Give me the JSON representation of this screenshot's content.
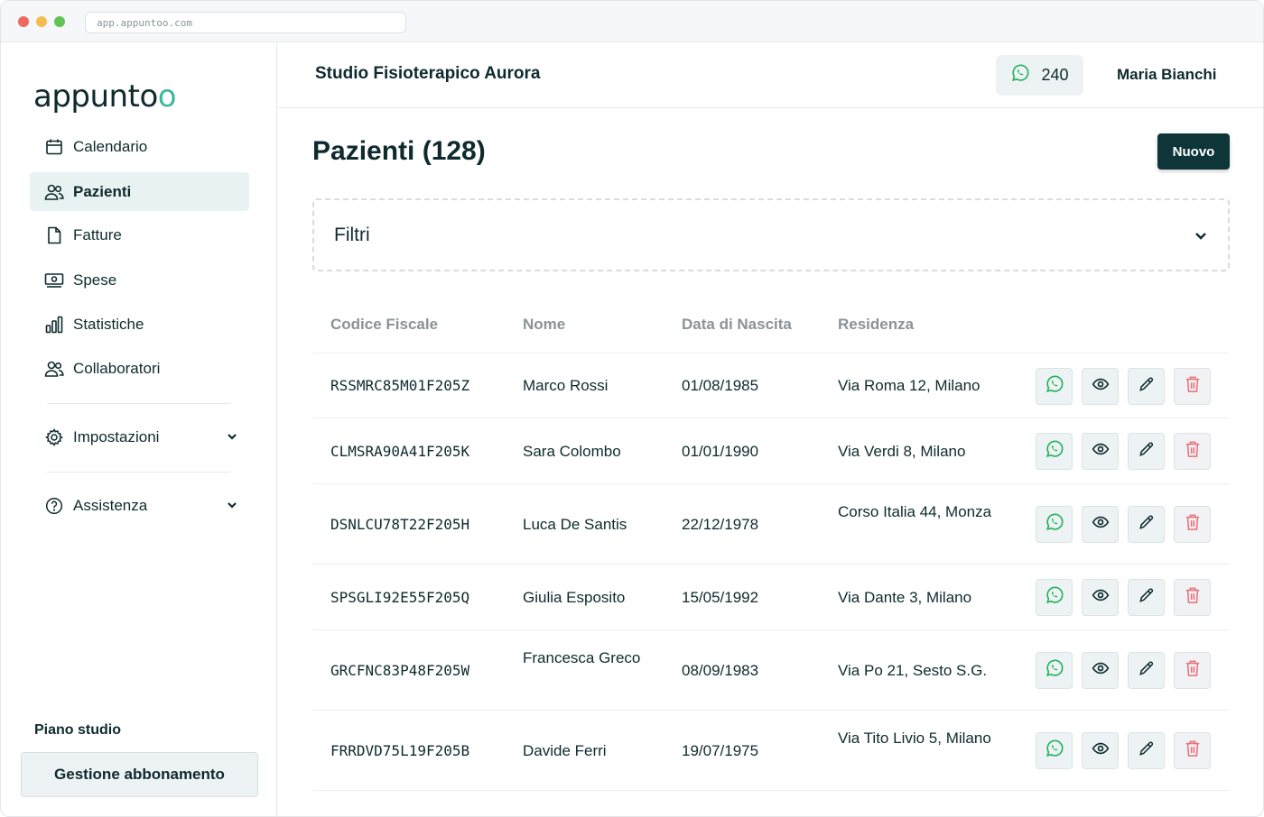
{
  "browser": {
    "url": "app.appuntoo.com"
  },
  "brand": {
    "logo_main": "appunt",
    "logo_o1": "o",
    "logo_o2": "o"
  },
  "sidebar": {
    "items": [
      {
        "label": "Calendario",
        "icon": "calendar-icon"
      },
      {
        "label": "Pazienti",
        "icon": "users-icon",
        "active": true
      },
      {
        "label": "Fatture",
        "icon": "file-icon"
      },
      {
        "label": "Spese",
        "icon": "cash-icon"
      },
      {
        "label": "Statistiche",
        "icon": "chart-icon"
      },
      {
        "label": "Collaboratori",
        "icon": "users-icon"
      },
      {
        "label": "Impostazioni",
        "icon": "gear-icon"
      },
      {
        "label": "Assistenza",
        "icon": "help-icon"
      }
    ],
    "plan_label": "Piano studio",
    "plan_button": "Gestione abbonamento"
  },
  "header": {
    "studio_name": "Studio Fisioterapico Aurora",
    "whatsapp_count": "240",
    "user_name": "Maria Bianchi"
  },
  "main": {
    "title": "Pazienti (128)",
    "new_button": "Nuovo",
    "filters_label": "Filtri",
    "columns": [
      "Codice Fiscale",
      "Nome",
      "Data di Nascita",
      "Residenza"
    ],
    "rows": [
      {
        "cf": "RSSMRC85M01F205Z",
        "name": "Marco Rossi",
        "dob": "01/08/1985",
        "address": "Via Roma 12, Milano"
      },
      {
        "cf": "CLMSRA90A41F205K",
        "name": "Sara Colombo",
        "dob": "01/01/1990",
        "address": "Via Verdi 8, Milano"
      },
      {
        "cf": "DSNLCU78T22F205H",
        "name": "Luca De Santis",
        "dob": "22/12/1978",
        "address": "Corso Italia 44, Monza"
      },
      {
        "cf": "SPSGLI92E55F205Q",
        "name": "Giulia Esposito",
        "dob": "15/05/1992",
        "address": "Via Dante 3, Milano"
      },
      {
        "cf": "GRCFNC83P48F205W",
        "name": "Francesca Greco",
        "dob": "08/09/1983",
        "address": "Via Po 21, Sesto S.G."
      },
      {
        "cf": "FRRDVD75L19F205B",
        "name": "Davide Ferri",
        "dob": "19/07/1975",
        "address": "Via Tito Livio 5, Milano"
      }
    ]
  },
  "colors": {
    "accent": "#3fb89b",
    "dark": "#0e3538",
    "danger": "#e8707a",
    "whatsapp": "#25b35a"
  }
}
